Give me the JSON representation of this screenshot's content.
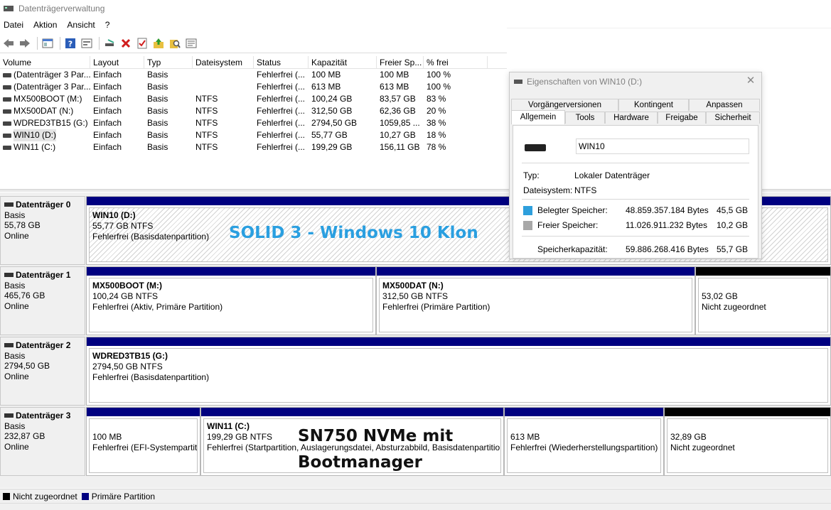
{
  "window": {
    "title": "Datenträgerverwaltung"
  },
  "menu": [
    "Datei",
    "Aktion",
    "Ansicht",
    "?"
  ],
  "colors": {
    "primary_partition": "#000080",
    "unallocated": "#000000",
    "used_space": "#2e9fdc",
    "free_space": "#a8a8a8",
    "overlay_blue": "#2a9fe0",
    "overlay_dark": "#111111"
  },
  "volume_table": {
    "columns": [
      "Volume",
      "Layout",
      "Typ",
      "Dateisystem",
      "Status",
      "Kapazität",
      "Freier Sp...",
      "% frei"
    ],
    "rows": [
      [
        "(Datenträger 3 Par...",
        "Einfach",
        "Basis",
        "",
        "Fehlerfrei (...",
        "100 MB",
        "100 MB",
        "100 %"
      ],
      [
        "(Datenträger 3 Par...",
        "Einfach",
        "Basis",
        "",
        "Fehlerfrei (...",
        "613 MB",
        "613 MB",
        "100 %"
      ],
      [
        "MX500BOOT (M:)",
        "Einfach",
        "Basis",
        "NTFS",
        "Fehlerfrei (...",
        "100,24 GB",
        "83,57 GB",
        "83 %"
      ],
      [
        "MX500DAT (N:)",
        "Einfach",
        "Basis",
        "NTFS",
        "Fehlerfrei (...",
        "312,50 GB",
        "62,36 GB",
        "20 %"
      ],
      [
        "WDRED3TB15 (G:)",
        "Einfach",
        "Basis",
        "NTFS",
        "Fehlerfrei (...",
        "2794,50 GB",
        "1059,85 ...",
        "38 %"
      ],
      [
        "WIN10 (D:)",
        "Einfach",
        "Basis",
        "NTFS",
        "Fehlerfrei (...",
        "55,77 GB",
        "10,27 GB",
        "18 %"
      ],
      [
        "WIN11 (C:)",
        "Einfach",
        "Basis",
        "NTFS",
        "Fehlerfrei (...",
        "199,29 GB",
        "156,11 GB",
        "78 %"
      ]
    ]
  },
  "disks": [
    {
      "name": "Datenträger 0",
      "type": "Basis",
      "size": "55,78 GB",
      "state": "Online",
      "partitions": [
        {
          "title": "WIN10  (D:)",
          "size": "55,77 GB NTFS",
          "status": "Fehlerfrei (Basisdatenpartition)"
        }
      ]
    },
    {
      "name": "Datenträger 1",
      "type": "Basis",
      "size": "465,76 GB",
      "state": "Online",
      "partitions": [
        {
          "title": "MX500BOOT  (M:)",
          "size": "100,24 GB NTFS",
          "status": "Fehlerfrei (Aktiv, Primäre Partition)"
        },
        {
          "title": "MX500DAT  (N:)",
          "size": "312,50 GB NTFS",
          "status": "Fehlerfrei (Primäre Partition)"
        },
        {
          "title": "",
          "size": "53,02 GB",
          "status": "Nicht zugeordnet"
        }
      ]
    },
    {
      "name": "Datenträger 2",
      "type": "Basis",
      "size": "2794,50 GB",
      "state": "Online",
      "partitions": [
        {
          "title": "WDRED3TB15  (G:)",
          "size": "2794,50 GB NTFS",
          "status": "Fehlerfrei (Basisdatenpartition)"
        }
      ]
    },
    {
      "name": "Datenträger 3",
      "type": "Basis",
      "size": "232,87 GB",
      "state": "Online",
      "partitions": [
        {
          "title": "",
          "size": "100 MB",
          "status": "Fehlerfrei (EFI-Systempartiti"
        },
        {
          "title": "WIN11  (C:)",
          "size": "199,29 GB NTFS",
          "status": "Fehlerfrei (Startpartition, Auslagerungsdatei, Absturzabbild, Basisdatenpartition"
        },
        {
          "title": "",
          "size": "613 MB",
          "status": "Fehlerfrei (Wiederherstellungspartition)"
        },
        {
          "title": "",
          "size": "32,89 GB",
          "status": "Nicht zugeordnet"
        }
      ]
    }
  ],
  "annotations": {
    "solid": "SOLID 3 - Windows 10 Klon",
    "sn750_line1": "SN750 NVMe mit",
    "sn750_line2": "Bootmanager"
  },
  "legend": {
    "unallocated": "Nicht zugeordnet",
    "primary": "Primäre Partition"
  },
  "properties_dialog": {
    "title": "Eigenschaften von WIN10 (D:)",
    "tabs_top": [
      "Vorgängerversionen",
      "Kontingent",
      "Anpassen"
    ],
    "tabs_bottom": [
      "Allgemein",
      "Tools",
      "Hardware",
      "Freigabe",
      "Sicherheit"
    ],
    "volume_name": "WIN10",
    "type_label": "Typ:",
    "type_value": "Lokaler Datenträger",
    "fs_label": "Dateisystem:",
    "fs_value": "NTFS",
    "used_label": "Belegter Speicher:",
    "used_bytes": "48.859.357.184 Bytes",
    "used_gb": "45,5 GB",
    "free_label": "Freier Speicher:",
    "free_bytes": "11.026.911.232 Bytes",
    "free_gb": "10,2 GB",
    "cap_label": "Speicherkapazität:",
    "cap_bytes": "59.886.268.416 Bytes",
    "cap_gb": "55,7 GB"
  }
}
